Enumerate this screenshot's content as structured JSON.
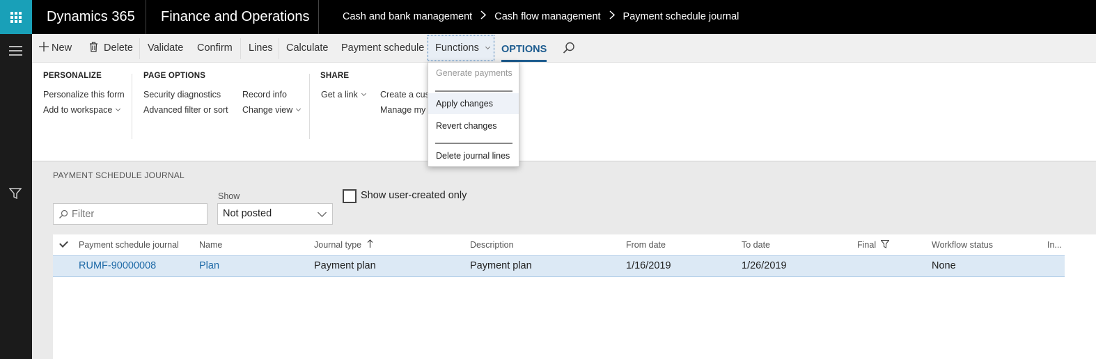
{
  "topbar": {
    "brand": "Dynamics 365",
    "app_name": "Finance and Operations",
    "breadcrumb": [
      "Cash and bank management",
      "Cash flow management",
      "Payment schedule journal"
    ]
  },
  "actionpane": {
    "new_label": "New",
    "delete_label": "Delete",
    "validate_label": "Validate",
    "confirm_label": "Confirm",
    "lines_label": "Lines",
    "calculate_label": "Calculate",
    "payment_schedule_label": "Payment schedule",
    "functions_label": "Functions",
    "options_label": "OPTIONS"
  },
  "ribbon": {
    "personalize": {
      "heading": "PERSONALIZE",
      "items": [
        "Personalize this form",
        "Add to workspace"
      ]
    },
    "page_options": {
      "heading": "PAGE OPTIONS",
      "col1": [
        "Security diagnostics",
        "Advanced filter or sort"
      ],
      "col2": [
        "Record info",
        "Change view"
      ]
    },
    "share": {
      "heading": "SHARE",
      "get_link": "Get a link",
      "col2": [
        "Create a cust",
        "Manage my"
      ]
    }
  },
  "functions_menu": {
    "items": [
      "Generate payments",
      "Apply changes",
      "Revert changes",
      "Delete journal lines"
    ]
  },
  "page": {
    "title": "PAYMENT SCHEDULE JOURNAL",
    "filter_placeholder": "Filter",
    "show_label": "Show",
    "show_value": "Not posted",
    "user_created_label": "Show user-created only"
  },
  "grid": {
    "columns": [
      "Payment schedule journal",
      "Name",
      "Journal type",
      "Description",
      "From date",
      "To date",
      "Final",
      "Workflow status",
      "In..."
    ],
    "rows": [
      {
        "journal": "RUMF-90000008",
        "name": "Plan",
        "journal_type": "Payment plan",
        "description": "Payment plan",
        "from_date": "1/16/2019",
        "to_date": "1/26/2019",
        "final": "",
        "workflow_status": "None"
      }
    ]
  },
  "colors": {
    "accent": "#19a0b8",
    "link": "#1f6aa7",
    "options_tab": "#1d5c8f",
    "selected_row": "#dce9f5"
  }
}
